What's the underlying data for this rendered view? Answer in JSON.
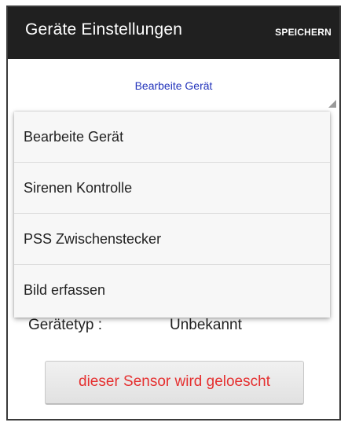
{
  "appbar": {
    "title": "Geräte Einstellungen",
    "save_label": "SPEICHERN"
  },
  "spinner": {
    "selected": "Bearbeite Gerät"
  },
  "dropdown": {
    "items": [
      {
        "label": "Bearbeite Gerät"
      },
      {
        "label": "Sirenen Kontrolle"
      },
      {
        "label": "PSS Zwischenstecker"
      },
      {
        "label": "Bild erfassen"
      }
    ]
  },
  "device_info": {
    "type_label": "Gerätetyp :",
    "type_value": "Unbekannt"
  },
  "delete_button": {
    "label": "dieser Sensor wird geloescht"
  },
  "colors": {
    "appbar_bg": "#202020",
    "spinner_text": "#2233bb",
    "delete_text": "#e53030"
  }
}
